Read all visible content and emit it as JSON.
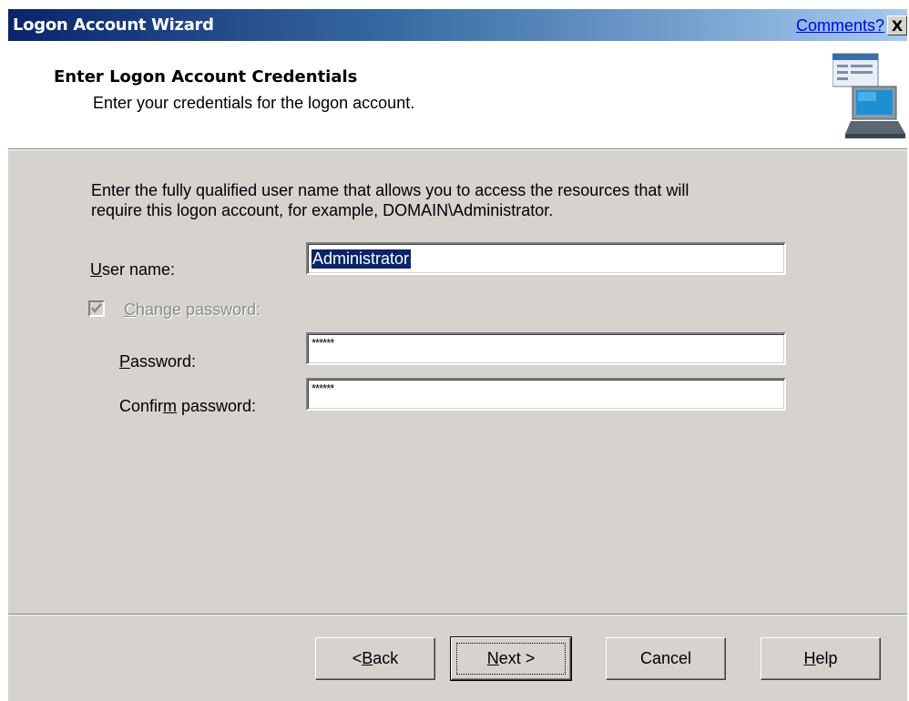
{
  "window": {
    "title": "Logon Account Wizard",
    "comments_link": "Comments?",
    "close_glyph": "X"
  },
  "header": {
    "title": "Enter Logon Account Credentials",
    "subtitle": "Enter your credentials for the logon account.",
    "graphic_icon": "computer-icon"
  },
  "body": {
    "intro_line1": "Enter the fully qualified user name that allows you to access the resources that will",
    "intro_line2": "require this logon account, for example, DOMAIN\\Administrator.",
    "username": {
      "label_mnemonic": "U",
      "label_rest": "ser name:",
      "value": "Administrator"
    },
    "change_password": {
      "label_mnemonic": "C",
      "label_rest": "hange password:",
      "checked": true,
      "disabled": true
    },
    "password": {
      "label_mnemonic": "P",
      "label_rest": "assword:",
      "value": "******"
    },
    "confirm_password": {
      "label_pre": "Confir",
      "label_mnemonic": "m",
      "label_rest": " password:",
      "value": "******"
    }
  },
  "buttons": {
    "back": {
      "pre": "< ",
      "mnemonic": "B",
      "rest": "ack"
    },
    "next": {
      "mnemonic": "N",
      "rest": "ext >"
    },
    "cancel": {
      "label": "Cancel"
    },
    "help": {
      "mnemonic": "H",
      "rest": "elp"
    }
  },
  "colors": {
    "titlebar_start": "#0a246a",
    "titlebar_end": "#a6caf0",
    "dialog_face": "#d6d3ce",
    "selection": "#0a246a"
  }
}
